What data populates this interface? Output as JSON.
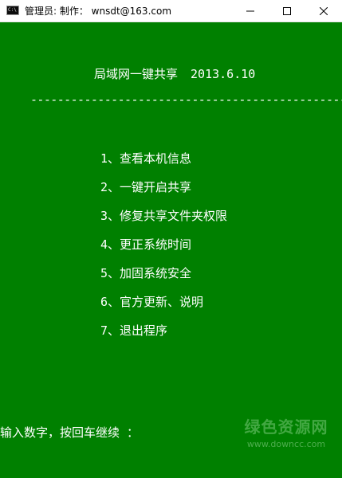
{
  "window": {
    "title": "管理员:  制作：  wnsdt@163.com",
    "icon": "console-icon",
    "icon_text": "C:\\",
    "controls": [
      "minimize-icon",
      "maximize-icon",
      "close-icon"
    ]
  },
  "console": {
    "background": "#008000",
    "text_color": "#ffffff",
    "header_title": "局域网一键共享",
    "header_date": "2013.6.10",
    "divider": "------------------------------------------------",
    "menu": [
      "1、查看本机信息",
      "2、一键开启共享",
      "3、修复共享文件夹权限",
      "4、更正系统时间",
      "5、加固系统安全",
      "6、官方更新、说明",
      "7、退出程序"
    ],
    "prompt": "输入数字，按回车继续 ："
  },
  "watermark": {
    "brand": "绿色资源网",
    "url": "www.downcc.com"
  }
}
